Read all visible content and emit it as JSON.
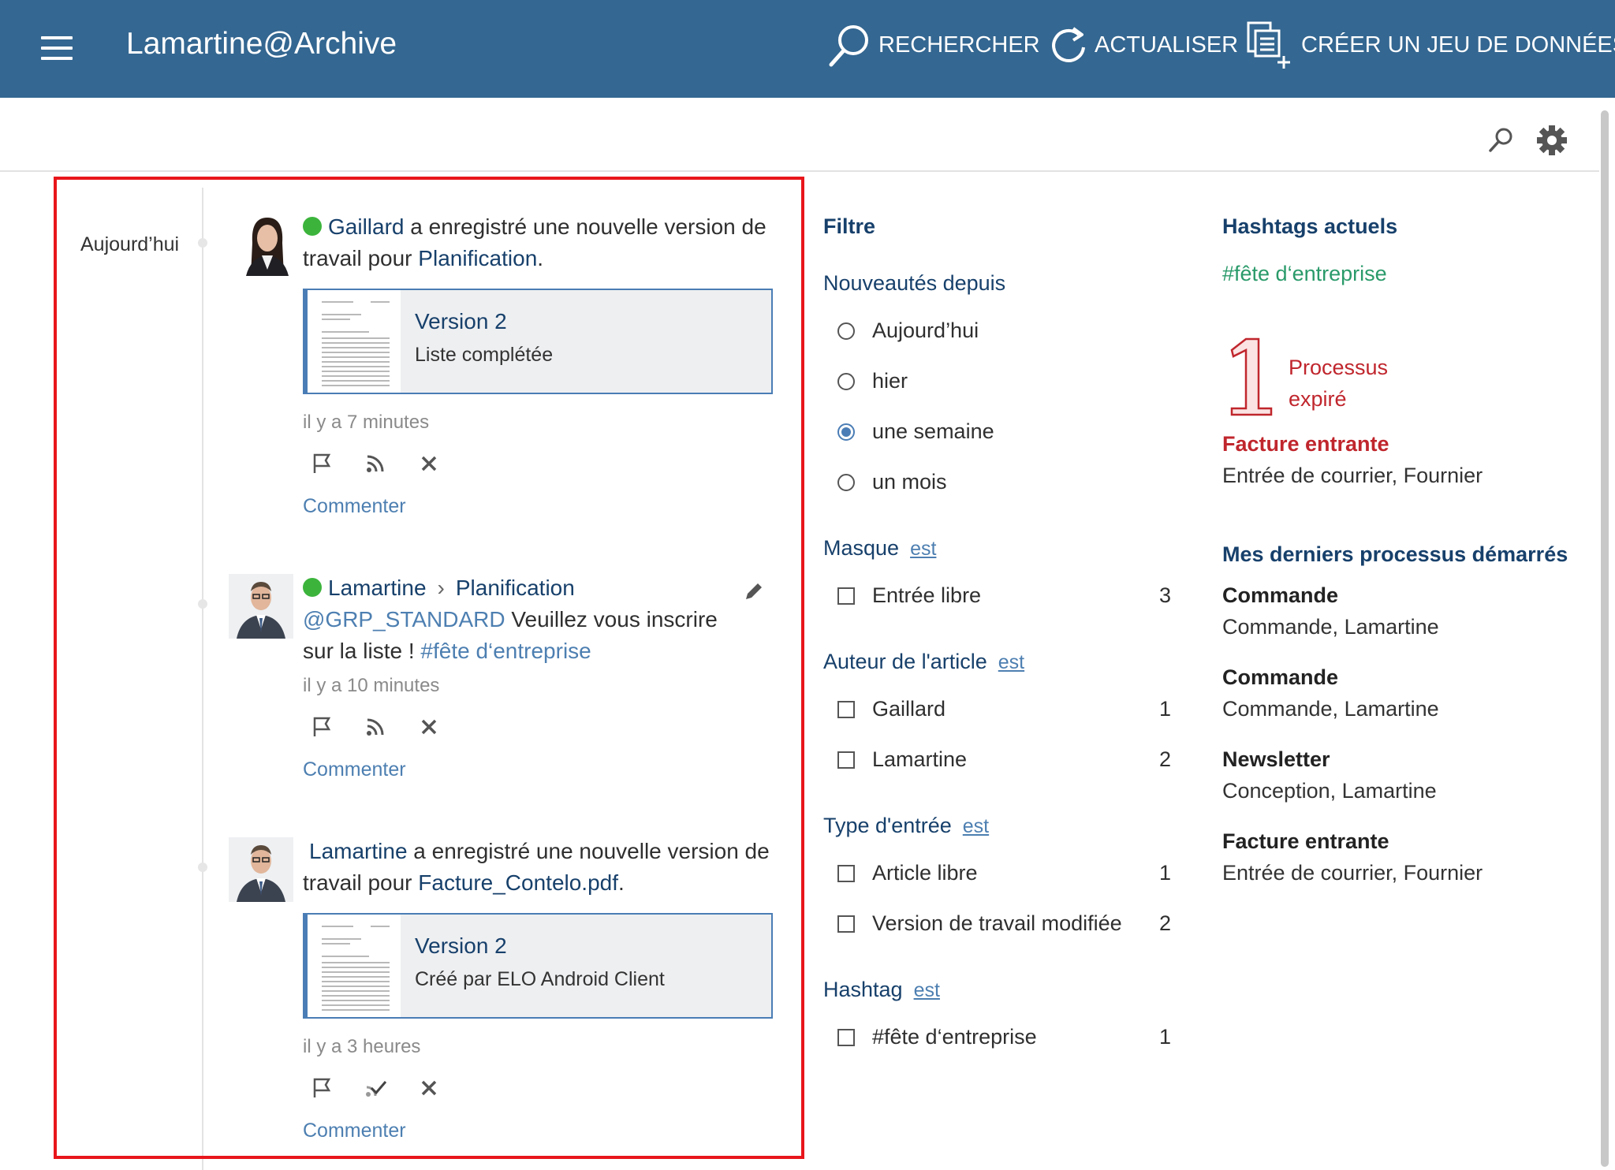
{
  "header": {
    "app_title": "Lamartine@Archive",
    "search_label": "RECHERCHER",
    "refresh_label": "ACTUALISER",
    "create_dataset_label": "CRÉER UN JEU DE DONNÉES"
  },
  "feed": {
    "date_label": "Aujourd’hui",
    "entries": [
      {
        "author": "Gaillard",
        "text_before": " a enregistré une nouvelle version de travail pour ",
        "target": "Planification",
        "text_after": ".",
        "card_title": "Version 2",
        "card_subtitle": "Liste complétée",
        "time": "il y a 7 minutes",
        "comment": "Commenter"
      },
      {
        "author": "Lamartine",
        "target": "Planification",
        "mention": "@GRP_STANDARD",
        "text": " Veuillez vous inscrire sur la liste ! ",
        "hashtag": "#fête d‘entreprise",
        "time": "il y a 10 minutes",
        "comment": "Commenter"
      },
      {
        "author": "Lamartine",
        "text_before": " a enregistré une nouvelle version de travail pour ",
        "target": "Facture_Contelo.pdf",
        "text_after": ".",
        "card_title": "Version 2",
        "card_subtitle": "Créé par ELO Android Client",
        "time": "il y a 3 heures",
        "comment": "Commenter"
      }
    ]
  },
  "filter": {
    "title": "Filtre",
    "since_title": "Nouveautés depuis",
    "since_options": [
      "Aujourd’hui",
      "hier",
      "une semaine",
      "un mois"
    ],
    "since_selected": "une semaine",
    "est": "est",
    "mask_title": "Masque",
    "mask_items": [
      {
        "label": "Entrée libre",
        "count": "3"
      }
    ],
    "author_title": "Auteur de l'article",
    "author_items": [
      {
        "label": "Gaillard",
        "count": "1"
      },
      {
        "label": "Lamartine",
        "count": "2"
      }
    ],
    "type_title": "Type d'entrée",
    "type_items": [
      {
        "label": "Article libre",
        "count": "1"
      },
      {
        "label": "Version de travail modifiée",
        "count": "2"
      }
    ],
    "hashtag_title": "Hashtag",
    "hashtag_items": [
      {
        "label": "#fête d‘entreprise",
        "count": "1"
      }
    ]
  },
  "right": {
    "hashtags_title": "Hashtags actuels",
    "hashtag": "#fête d‘entreprise",
    "expired_count": "1",
    "expired_label_1": "Processus",
    "expired_label_2": "expiré",
    "expired_name": "Facture entrante",
    "expired_detail": "Entrée de courrier, Fournier",
    "recent_title": "Mes derniers processus démarrés",
    "recent": [
      {
        "name": "Commande",
        "detail": "Commande, Lamartine"
      },
      {
        "name": "Commande",
        "detail": "Commande, Lamartine"
      },
      {
        "name": "Newsletter",
        "detail": "Conception, Lamartine"
      },
      {
        "name": "Facture entrante",
        "detail": "Entrée de courrier, Fournier"
      }
    ]
  },
  "colors": {
    "header_bg": "#346791",
    "link": "#17406b",
    "accent": "#4a7db5",
    "online": "#3cb43c",
    "hashtag_green": "#2a9a6a",
    "expired_red": "#c0262d",
    "highlight_frame": "#e8161b"
  }
}
